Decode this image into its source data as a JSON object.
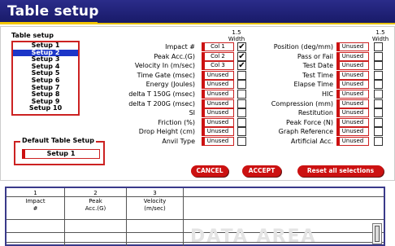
{
  "header": {
    "title": "Table setup"
  },
  "setup": {
    "label": "Table setup",
    "items": [
      "Setup 1",
      "Setup 2",
      "Setup 3",
      "Setup 4",
      "Setup 5",
      "Setup 6",
      "Setup 7",
      "Setup 8",
      "Setup 9",
      "Setup 10"
    ],
    "selected_index": 1
  },
  "default_setup": {
    "legend": "Default Table Setup",
    "value": "Setup 1"
  },
  "width_header": [
    "1.5",
    "Width"
  ],
  "left_rows": [
    {
      "label": "Impact #",
      "value": "Col 1",
      "checked": true
    },
    {
      "label": "Peak Acc.(G)",
      "value": "Col 2",
      "checked": true
    },
    {
      "label": "Velocity In (m/sec)",
      "value": "Col 3",
      "checked": true
    },
    {
      "label": "Time Gate (msec)",
      "value": "Unused",
      "checked": false
    },
    {
      "label": "Energy (Joules)",
      "value": "Unused",
      "checked": false
    },
    {
      "label": "delta T 150G (msec)",
      "value": "Unused",
      "checked": false
    },
    {
      "label": "delta T 200G (msec)",
      "value": "Unused",
      "checked": false
    },
    {
      "label": "SI",
      "value": "Unused",
      "checked": false
    },
    {
      "label": "Friction (%)",
      "value": "Unused",
      "checked": false
    },
    {
      "label": "Drop Height (cm)",
      "value": "Unused",
      "checked": false
    },
    {
      "label": "Anvil Type",
      "value": "Unused",
      "checked": false
    }
  ],
  "right_rows": [
    {
      "label": "Position (deg/mm)",
      "value": "Unused",
      "checked": false
    },
    {
      "label": "Pass or Fail",
      "value": "Unused",
      "checked": false
    },
    {
      "label": "Test Date",
      "value": "Unused",
      "checked": false
    },
    {
      "label": "Test Time",
      "value": "Unused",
      "checked": false
    },
    {
      "label": "Elapse Time",
      "value": "Unused",
      "checked": false
    },
    {
      "label": "HIC",
      "value": "Unused",
      "checked": false
    },
    {
      "label": "Compression (mm)",
      "value": "Unused",
      "checked": false
    },
    {
      "label": "Restitution",
      "value": "Unused",
      "checked": false
    },
    {
      "label": "Peak Force (N)",
      "value": "Unused",
      "checked": false
    },
    {
      "label": "Graph Reference",
      "value": "Unused",
      "checked": false
    },
    {
      "label": "Artificial Acc.",
      "value": "Unused",
      "checked": false
    }
  ],
  "buttons": {
    "cancel": "CANCEL",
    "accept": "ACCEPT",
    "reset": "Reset all selections"
  },
  "data_area": {
    "columns": [
      {
        "num": "1",
        "head": [
          "Impact",
          "#"
        ]
      },
      {
        "num": "2",
        "head": [
          "Peak",
          "Acc.(G)"
        ]
      },
      {
        "num": "3",
        "head": [
          "Velocity",
          "(m/sec)"
        ]
      }
    ],
    "watermark": "DATA AREA"
  },
  "colors": {
    "accent": "#cc1111",
    "titlebar": "#1f2178",
    "selection": "#1c36c8",
    "stripe": "#f3c600"
  }
}
